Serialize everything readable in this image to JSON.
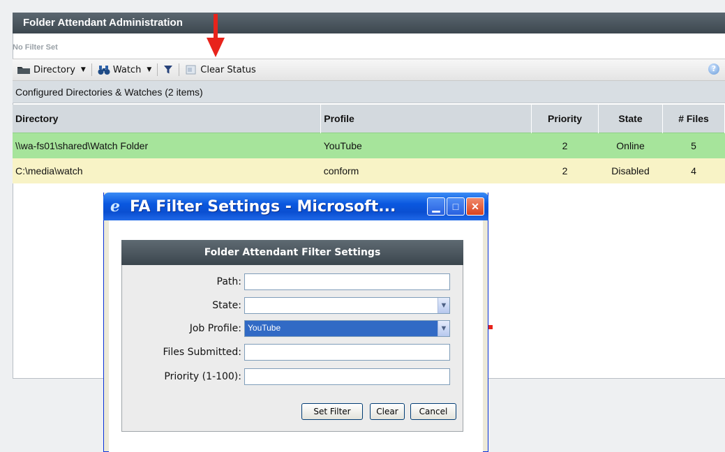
{
  "panel": {
    "title": "Folder Attendant Administration",
    "filter_status": "No Filter Set"
  },
  "toolbar": {
    "directory_label": "Directory",
    "watch_label": "Watch",
    "clear_status_label": "Clear Status",
    "help_label": "?"
  },
  "list": {
    "heading": "Configured Directories & Watches (2 items)",
    "columns": [
      "Directory",
      "Profile",
      "Priority",
      "State",
      "# Files"
    ],
    "rows": [
      {
        "directory": "\\\\wa-fs01\\shared\\Watch Folder",
        "profile": "YouTube",
        "priority": "2",
        "state": "Online",
        "files": "5"
      },
      {
        "directory": "C:\\media\\watch",
        "profile": "conform",
        "priority": "2",
        "state": "Disabled",
        "files": "4"
      }
    ]
  },
  "dialog": {
    "window_title": "FA Filter Settings - Microsoft...",
    "form_title": "Folder Attendant Filter Settings",
    "fields": {
      "path_label": "Path:",
      "path_value": "",
      "state_label": "State:",
      "state_value": "",
      "job_profile_label": "Job Profile:",
      "job_profile_value": "YouTube",
      "files_submitted_label": "Files Submitted:",
      "files_submitted_value": "",
      "priority_label": "Priority (1-100):",
      "priority_value": ""
    },
    "buttons": {
      "set_filter": "Set Filter",
      "clear": "Clear",
      "cancel": "Cancel"
    }
  },
  "colors": {
    "online_row": "#a6e49b",
    "disabled_row": "#f8f3c6",
    "annotation_arrow": "#e8231b",
    "title_bar": "#0a58e0"
  }
}
